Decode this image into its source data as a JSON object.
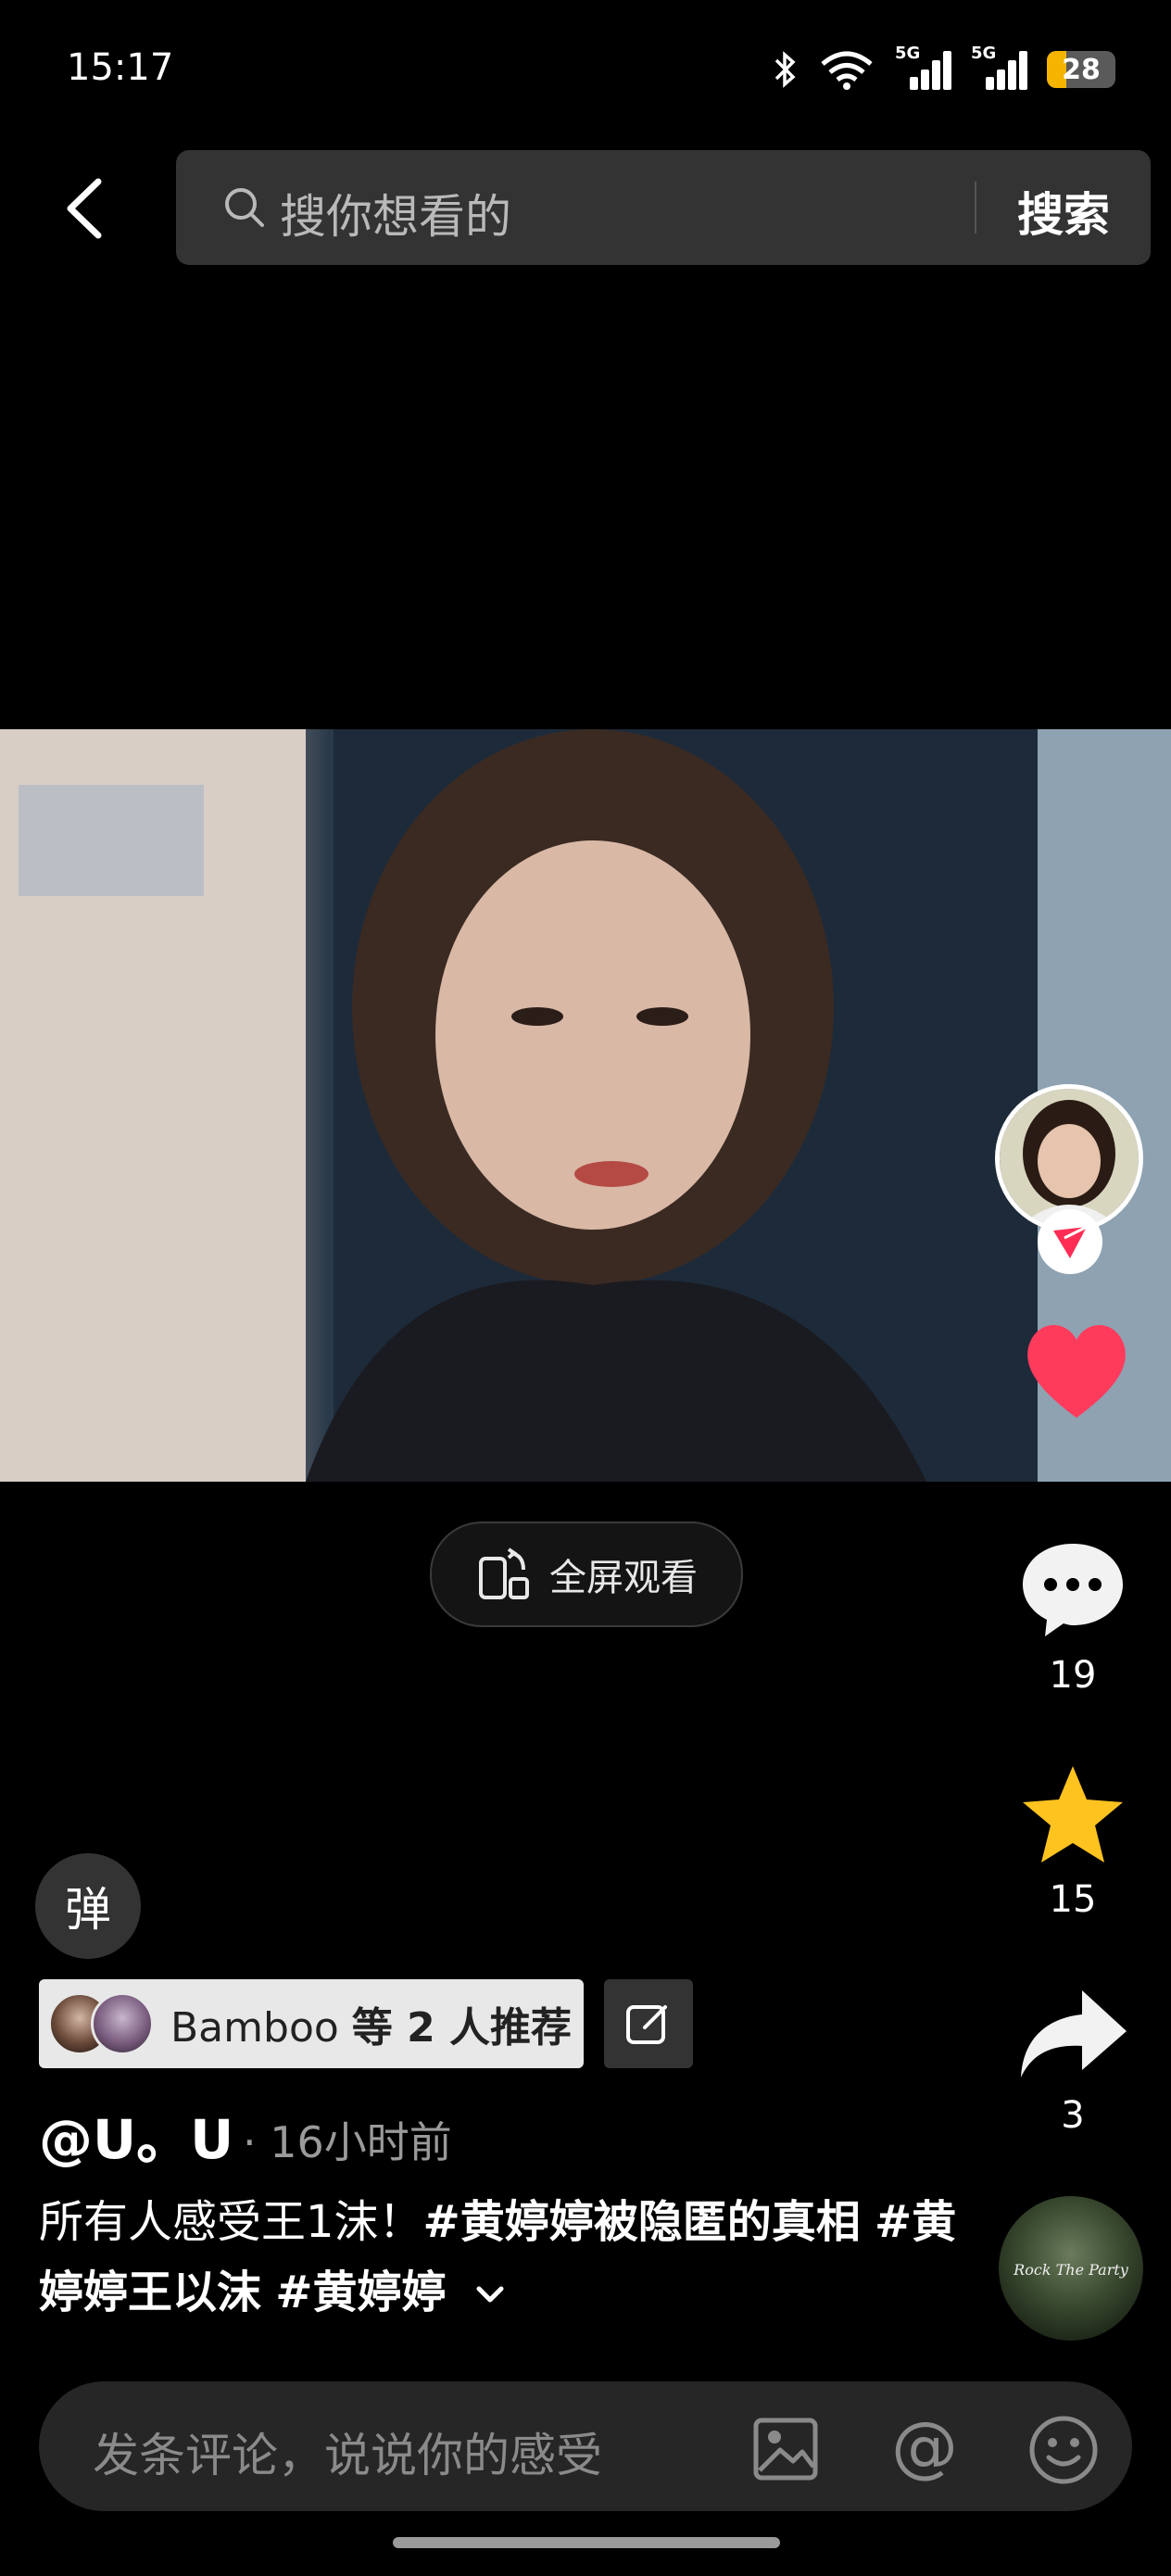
{
  "status_bar": {
    "time": "15:17",
    "battery": "28",
    "battery_level": 0.28,
    "network_1": "5G",
    "network_2": "5G",
    "icons": [
      "bluetooth-icon",
      "wifi-icon",
      "signal-icon",
      "signal-icon",
      "battery-icon"
    ]
  },
  "search": {
    "placeholder": "搜你想看的",
    "button_label": "搜索"
  },
  "video": {
    "fullscreen_label": "全屏观看"
  },
  "right_rail": {
    "comments_count": "19",
    "favorites_count": "15",
    "shares_count": "3",
    "music_disc_text": "Rock The Party",
    "like_color": "#ff3b5c",
    "star_color": "#ffc31f"
  },
  "post": {
    "danmaku_label": "弹",
    "recommend_user": "Bamboo",
    "recommend_suffix": "等 2 人推荐",
    "author": "@U。U",
    "time_ago": "· 16小时前",
    "caption_text": "所有人感受王1沫！",
    "tags": [
      "#黄婷婷被隐匿的真相",
      "#黄婷婷王以沫",
      "#黄婷婷"
    ]
  },
  "comment_bar": {
    "placeholder": "发条评论，说说你的感受",
    "at_symbol": "@"
  }
}
